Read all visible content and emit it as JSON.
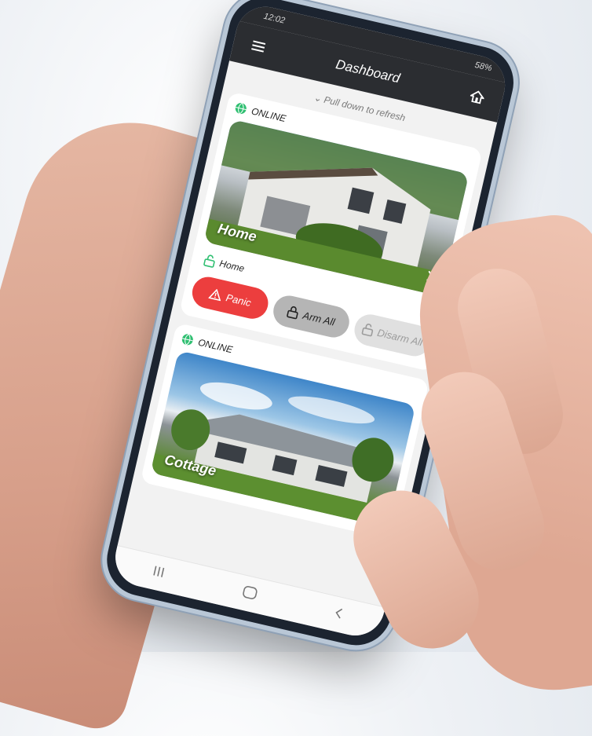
{
  "status_bar": {
    "time": "12:02",
    "battery": "58%"
  },
  "app_bar": {
    "title": "Dashboard"
  },
  "refresh_hint": "Pull down to refresh",
  "sites": [
    {
      "status": "ONLINE",
      "name": "Home",
      "partition": "Home",
      "buttons": {
        "panic": "Panic",
        "arm": "Arm All",
        "disarm": "Disarm All"
      }
    },
    {
      "status": "ONLINE",
      "name": "Cottage"
    }
  ],
  "colors": {
    "appbar": "#2b2d31",
    "online": "#2fbf71",
    "panic": "#ec3e3e",
    "arm": "#b5b5b5",
    "disarm": "#e0e0e0"
  },
  "icons": [
    "menu-icon",
    "home-icon",
    "chevron-down-icon",
    "globe-icon",
    "chevron-right-icon",
    "unlock-icon",
    "warning-icon",
    "lock-icon",
    "recent-apps-icon",
    "home-nav-icon",
    "back-icon"
  ]
}
